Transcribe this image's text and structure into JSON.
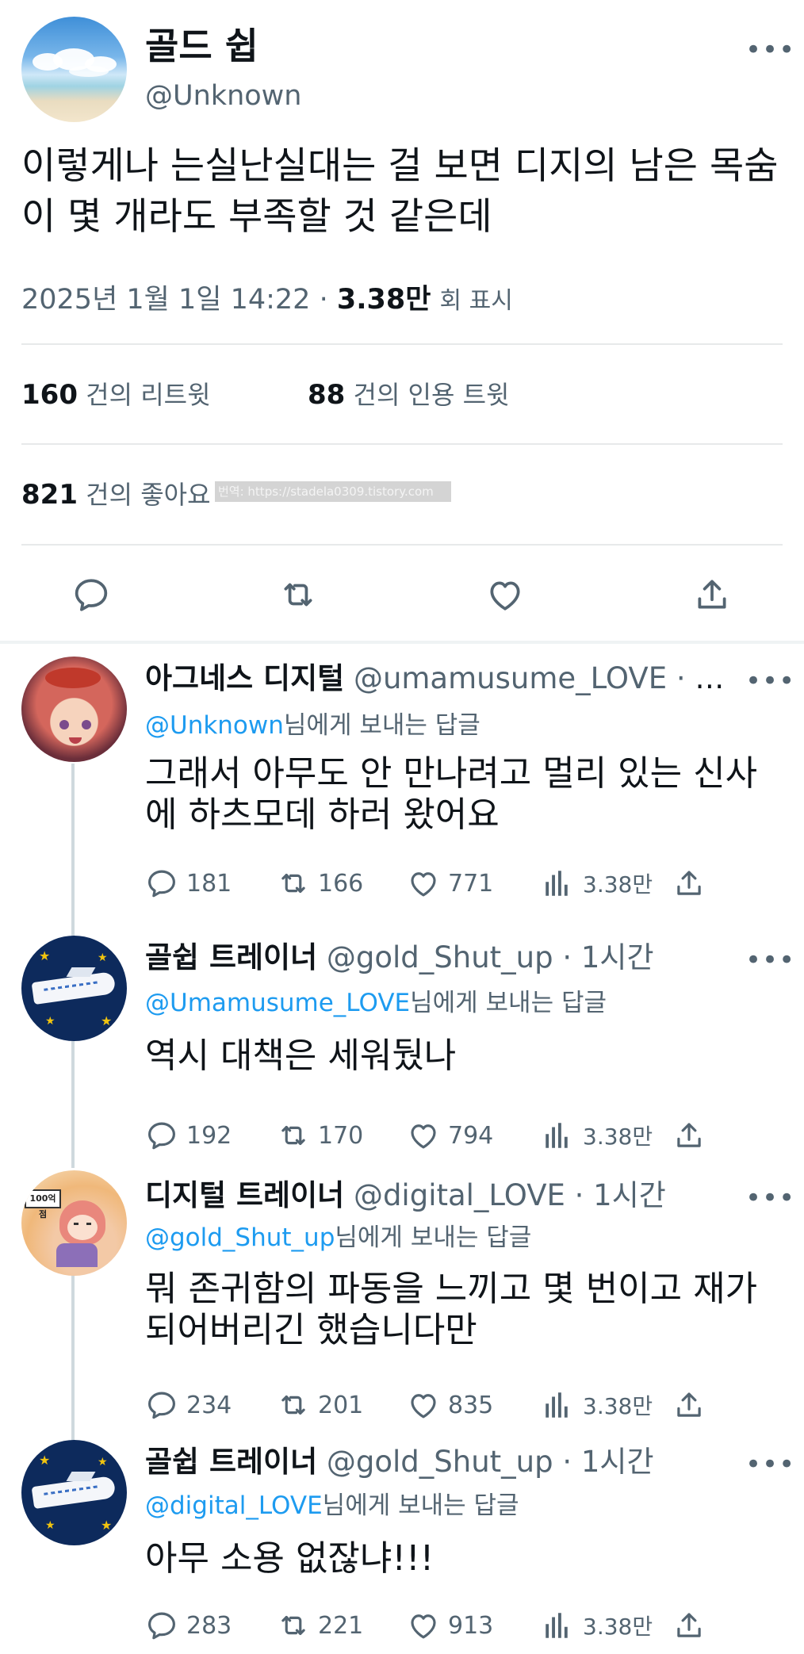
{
  "main": {
    "name": "골드 쉽",
    "handle": "@Unknown",
    "text": "이렇게나 는실난실대는 걸 보면 디지의 남은 목숨이 몇 개라도 부족할 것 같은데",
    "date": "2025년 1월 1일  14:22 ·",
    "views_count": "3.38만",
    "views_label": "회 표시",
    "retweets": {
      "count": "160",
      "label": "건의 리트윗"
    },
    "quotes": {
      "count": "88",
      "label": "건의 인용 트윗"
    },
    "likes": {
      "count": "821",
      "label": "건의 좋아요"
    },
    "watermark": "번역: https://stadela0309.tistory.com"
  },
  "replies": [
    {
      "name": "아그네스 디지털",
      "handle": "@umamusume_LOVE · 1…",
      "mention": "@Unknown",
      "reply_suffix": "님에게 보내는 답글",
      "text": "그래서 아무도 안 만나려고 멀리 있는 신사에 하츠모데 하러 왔어요",
      "comments": "181",
      "retweets": "166",
      "likes": "771",
      "views": "3.38만"
    },
    {
      "name": "골쉽 트레이너",
      "handle": "@gold_Shut_up · 1시간",
      "mention": "@Umamusume_LOVE",
      "reply_suffix": "님에게 보내는 답글",
      "text": "역시 대책은 세워뒀나",
      "comments": "192",
      "retweets": "170",
      "likes": "794",
      "views": "3.38만"
    },
    {
      "name": "디지털 트레이너",
      "handle": "@digital_LOVE · 1시간",
      "mention": "@gold_Shut_up",
      "reply_suffix": "님에게 보내는 답글",
      "text": "뭐 존귀함의 파동을 느끼고 몇 번이고 재가 되어버리긴 했습니다만",
      "comments": "234",
      "retweets": "201",
      "likes": "835",
      "views": "3.38만",
      "avatar_sign": "100억점"
    },
    {
      "name": "골쉽 트레이너",
      "handle": "@gold_Shut_up · 1시간",
      "mention": "@digital_LOVE",
      "reply_suffix": "님에게 보내는 답글",
      "text": "아무 소용 없잖냐!!!",
      "comments": "283",
      "retweets": "221",
      "likes": "913",
      "views": "3.38만"
    }
  ],
  "colors": {
    "accent": "#1d9bf0",
    "secondary_text": "#536471",
    "divider": "#e7e9ea"
  },
  "icons": [
    "more-icon",
    "reply-icon",
    "retweet-icon",
    "like-icon",
    "share-icon",
    "views-icon"
  ]
}
